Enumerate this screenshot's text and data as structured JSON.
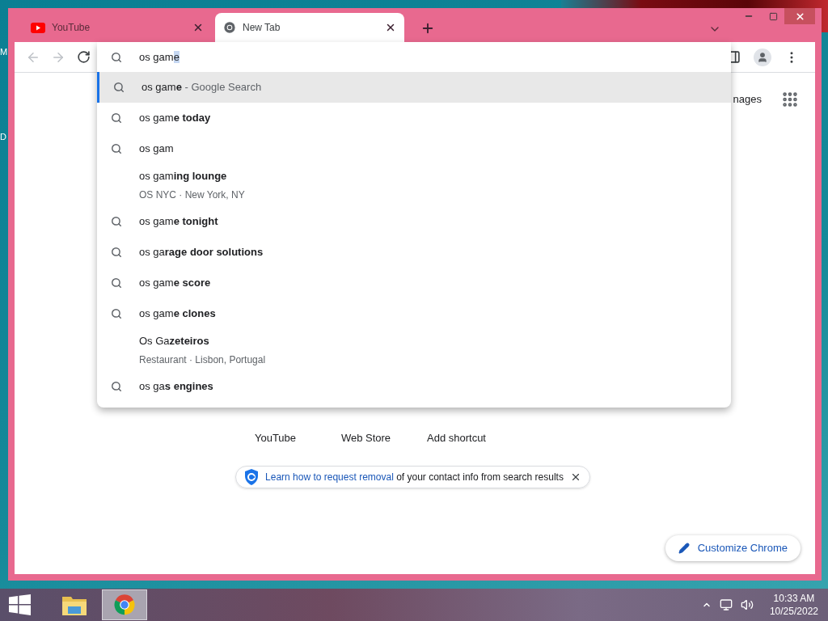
{
  "desktop_labels": [
    "M",
    "D"
  ],
  "tabs": [
    {
      "title": "YouTube",
      "kind": "youtube",
      "selected": false
    },
    {
      "title": "New Tab",
      "kind": "chrome",
      "selected": true
    }
  ],
  "omnibox": {
    "value": "os gam",
    "selected_text": "e"
  },
  "suggestions": [
    {
      "kind": "search",
      "text": "os gam**e**",
      "suffix": "- Google Search",
      "selected": true
    },
    {
      "kind": "search",
      "text": "os gam**e today**",
      "selected": false
    },
    {
      "kind": "search",
      "text": "os gam",
      "selected": false
    },
    {
      "kind": "place",
      "text": "os gam**ing lounge**",
      "detail": "OS NYC · New York, NY",
      "selected": false
    },
    {
      "kind": "search",
      "text": "os gam**e tonight**",
      "selected": false
    },
    {
      "kind": "search",
      "text": "os ga**rage door solutions**",
      "selected": false
    },
    {
      "kind": "search",
      "text": "os gam**e score**",
      "selected": false
    },
    {
      "kind": "search",
      "text": "os gam**e clones**",
      "selected": false
    },
    {
      "kind": "place",
      "text": "Os Ga**zeteiros**",
      "detail": "Restaurant · Lisbon, Portugal",
      "selected": false
    },
    {
      "kind": "search",
      "text": "os ga**s engines**",
      "selected": false
    }
  ],
  "header_link": "nages",
  "shortcuts": [
    "YouTube",
    "Web Store",
    "Add shortcut"
  ],
  "notice": {
    "link": "Learn how to request removal",
    "text": "of your contact info from search results"
  },
  "customize_button": "Customize Chrome",
  "taskbar": {
    "apps": [
      {
        "kind": "explorer",
        "selected": false
      },
      {
        "kind": "chrome",
        "selected": true
      }
    ],
    "time": "10:33 AM",
    "date": "10/25/2022"
  }
}
